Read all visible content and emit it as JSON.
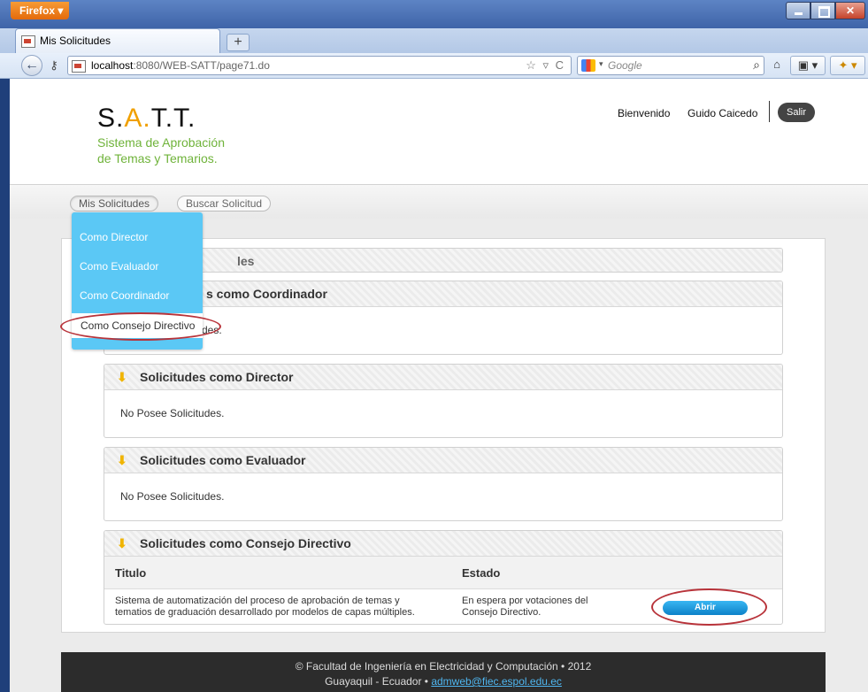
{
  "browser": {
    "menu_label": "Firefox ▾",
    "tab_title": "Mis Solicitudes",
    "new_tab": "+",
    "url_host": "localhost",
    "url_path": ":8080/WEB-SATT/page71.do",
    "url_actions": "☆ ▿ C",
    "search_placeholder": "Google",
    "icons": [
      "back-arrow-icon",
      "identity-key-icon",
      "favicon-icon",
      "star-icon",
      "reload-icon",
      "google-icon",
      "search-icon",
      "home-icon",
      "bookmarks-icon",
      "addon-icon",
      "minimize-icon",
      "maximize-icon",
      "close-icon"
    ]
  },
  "header": {
    "logo_s": "S.",
    "logo_a": "A.",
    "logo_tt": "T.T.",
    "tagline_1": "Sistema de Aprobación",
    "tagline_2": "de Temas y Temarios.",
    "welcome": "Bienvenido",
    "user": "Guido Caicedo",
    "logout": "Salir"
  },
  "nav": {
    "my_requests": "Mis Solicitudes",
    "search_request": "Buscar Solicitud"
  },
  "dropdown": [
    "Como Director",
    "Como Evaluador",
    "Como Coordinador",
    "Como Consejo Directivo"
  ],
  "panels": {
    "top_title_partial": "les",
    "coord_title_partial": "s como Coordinador",
    "coord_body_partial": "des.",
    "director_title": "Solicitudes como Director",
    "director_body": "No Posee Solicitudes.",
    "evaluador_title": "Solicitudes como Evaluador",
    "evaluador_body": "No Posee Solicitudes.",
    "consejo_title": "Solicitudes como Consejo Directivo"
  },
  "table": {
    "col_title": "Titulo",
    "col_state": "Estado",
    "rows": [
      {
        "title_1": "Sistema de automatización del proceso de aprobación de temas y",
        "title_2": "tematios de graduación desarrollado por modelos de capas múltiples.",
        "state_1": "En espera por votaciones del",
        "state_2": "Consejo Directivo.",
        "action": "Abrir"
      }
    ]
  },
  "footer": {
    "line1": "© Facultad de Ingeniería en Electricidad y Computación • 2012",
    "line2": "Guayaquil - Ecuador • ",
    "email": "admweb@fiec.espol.edu.ec"
  },
  "colors": {
    "accent_orange": "#f0a000",
    "tagline_green": "#6fb33a",
    "dropdown_blue": "#5bc8f5",
    "button_blue": "#0d82c8",
    "annotation_red": "#b8333a"
  }
}
